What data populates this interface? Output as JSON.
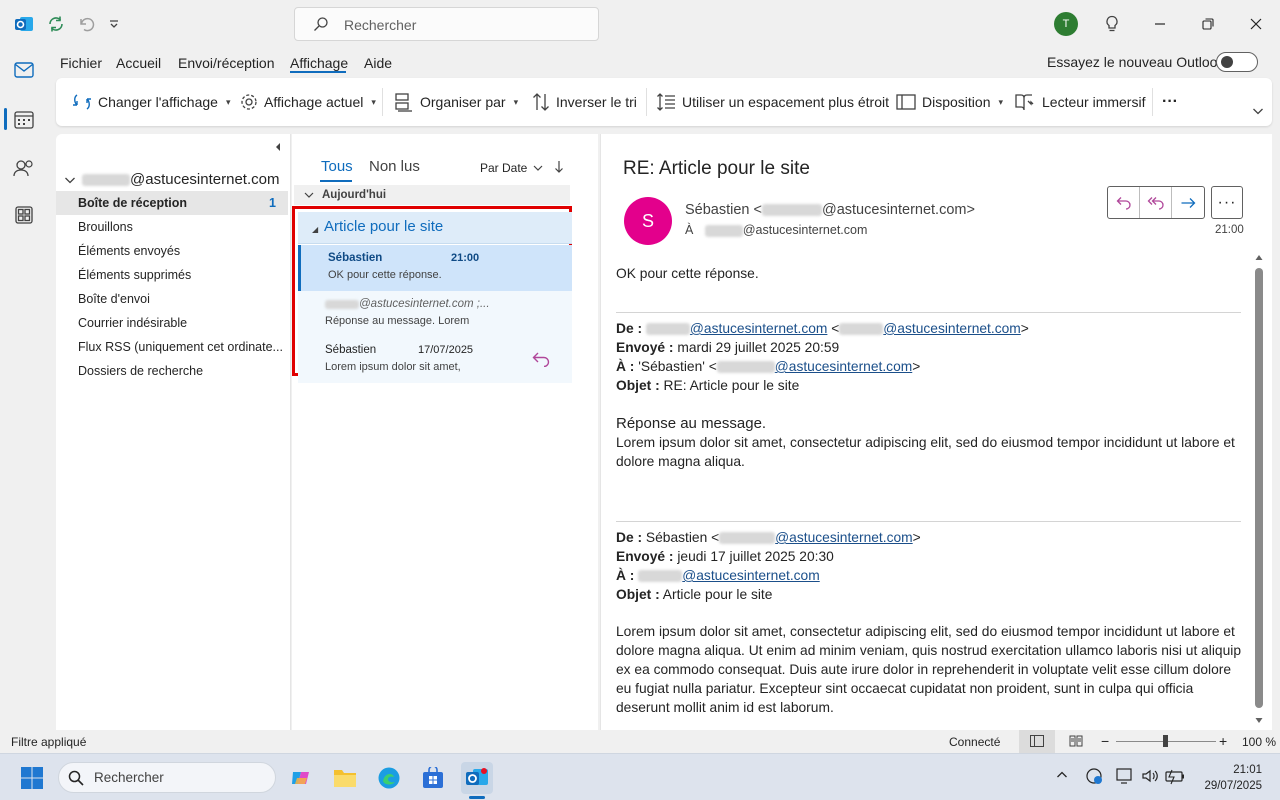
{
  "titlebar": {
    "search_placeholder": "Rechercher",
    "user_initial": "T"
  },
  "menu": {
    "tabs": [
      "Fichier",
      "Accueil",
      "Envoi/réception",
      "Affichage",
      "Aide"
    ],
    "active_tab": "Affichage",
    "try_new": "Essayez le nouveau Outlook"
  },
  "ribbon": {
    "change_view": "Changer l'affichage",
    "current_view": "Affichage actuel",
    "arrange_by": "Organiser par",
    "reverse_sort": "Inverser le tri",
    "compact_spacing": "Utiliser un espacement plus étroit",
    "layout": "Disposition",
    "immersive_reader": "Lecteur immersif",
    "more": "···"
  },
  "folders": {
    "account_domain": "@astucesinternet.com",
    "items": [
      {
        "label": "Boîte de réception",
        "count": "1",
        "selected": true
      },
      {
        "label": "Brouillons"
      },
      {
        "label": "Éléments envoyés"
      },
      {
        "label": "Éléments supprimés"
      },
      {
        "label": "Boîte d'envoi"
      },
      {
        "label": "Courrier indésirable"
      },
      {
        "label": "Flux RSS (uniquement cet ordinate..."
      },
      {
        "label": "Dossiers de recherche"
      }
    ]
  },
  "message_list": {
    "tab_all": "Tous",
    "tab_unread": "Non lus",
    "sort": "Par Date",
    "group": "Aujourd'hui",
    "conversation_subject": "Article pour le site",
    "items": [
      {
        "sender": "Sébastien",
        "time": "21:00",
        "preview": "OK pour cette réponse."
      },
      {
        "sender": "@astucesinternet.com ;...",
        "time": "",
        "preview": "Réponse au message.  Lorem"
      },
      {
        "sender": "Sébastien",
        "time": "17/07/2025",
        "preview": "Lorem ipsum dolor sit amet,"
      }
    ]
  },
  "reading": {
    "subject": "RE: Article pour le site",
    "avatar_initial": "S",
    "from_name": "Sébastien <",
    "from_domain": "@astucesinternet.com>",
    "to_prefix": "À",
    "to_domain": "@astucesinternet.com",
    "time": "21:00",
    "body_first": "OK pour cette réponse.",
    "h1": {
      "de_label": "De :",
      "de_domain1": "@astucesinternet.com",
      "de_mid": " <",
      "de_domain2": "@astucesinternet.com",
      "de_end": ">",
      "sent_label": "Envoyé :",
      "sent_value": " mardi 29 juillet 2025 20:59",
      "to_label": "À :",
      "to_value": " 'Sébastien' <",
      "to_domain": "@astucesinternet.com",
      "to_end": ">",
      "subject_label": "Objet :",
      "subject_value": " RE: Article pour le site"
    },
    "reply_title": "Réponse au message.",
    "reply_body": "Lorem ipsum dolor sit amet, consectetur adipiscing elit, sed do eiusmod tempor incididunt ut labore et dolore magna aliqua.",
    "h2": {
      "de_label": "De :",
      "de_value": " Sébastien <",
      "de_domain": "@astucesinternet.com",
      "de_end": ">",
      "sent_label": "Envoyé :",
      "sent_value": " jeudi 17 juillet 2025 20:30",
      "to_label": "À :",
      "to_domain": "@astucesinternet.com",
      "subject_label": "Objet :",
      "subject_value": " Article pour le site"
    },
    "orig_body": "Lorem ipsum dolor sit amet, consectetur adipiscing elit, sed do eiusmod tempor incididunt ut labore et dolore magna aliqua. Ut enim ad minim veniam, quis nostrud exercitation ullamco laboris nisi ut aliquip ex ea commodo consequat. Duis aute irure dolor in reprehenderit in voluptate velit esse cillum dolore eu fugiat nulla pariatur. Excepteur sint occaecat cupidatat non proident, sunt in culpa qui officia deserunt mollit anim id est laborum."
  },
  "statusbar": {
    "filter": "Filtre appliqué",
    "connected": "Connecté",
    "zoom": "100 %"
  },
  "taskbar": {
    "search_placeholder": "Rechercher",
    "time": "21:01",
    "date": "29/07/2025"
  },
  "colors": {
    "accent": "#0f6cbd",
    "highlight_box": "#e00000",
    "sender_avatar": "#e3008c",
    "user_avatar": "#2e7d32"
  }
}
